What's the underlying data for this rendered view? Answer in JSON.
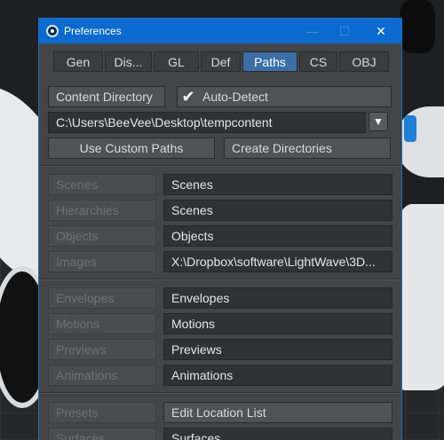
{
  "window": {
    "title": "Preferences",
    "minimize": "—",
    "maximize": "☐",
    "close": "✕"
  },
  "tabs": [
    {
      "label": "Gen"
    },
    {
      "label": "Dis..."
    },
    {
      "label": "GL"
    },
    {
      "label": "Def"
    },
    {
      "label": "Paths",
      "active": true
    },
    {
      "label": "CS"
    },
    {
      "label": "OBJ"
    }
  ],
  "content": {
    "content_directory_label": "Content Directory",
    "auto_detect_label": "Auto-Detect",
    "auto_detect_checked": true,
    "path_value": "C:\\Users\\BeeVee\\Desktop\\tempcontent",
    "use_custom_paths_label": "Use Custom Paths",
    "create_directories_label": "Create Directories"
  },
  "group1": [
    {
      "label": "Scenes",
      "value": "Scenes"
    },
    {
      "label": "Hierarchies",
      "value": "Scenes"
    },
    {
      "label": "Objects",
      "value": "Objects"
    },
    {
      "label": "Images",
      "value": "X:\\Dropbox\\software\\LightWave\\3D..."
    }
  ],
  "group2": [
    {
      "label": "Envelopes",
      "value": "Envelopes"
    },
    {
      "label": "Motions",
      "value": "Motions"
    },
    {
      "label": "Previews",
      "value": "Previews"
    },
    {
      "label": "Animations",
      "value": "Animations"
    }
  ],
  "group3": [
    {
      "label": "Presets",
      "value": "Edit Location List"
    },
    {
      "label": "Surfaces",
      "value": "Surfaces"
    }
  ],
  "icons": {
    "check": "check-icon",
    "chevron": "chevron-down-icon",
    "app": "lightwave-icon"
  }
}
